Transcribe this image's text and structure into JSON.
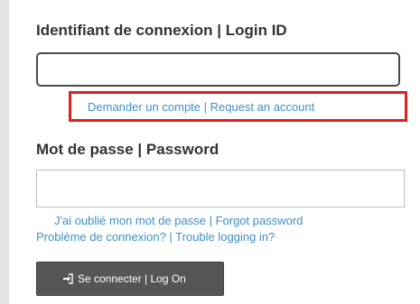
{
  "form": {
    "login_label": "Identifiant de connexion | Login ID",
    "login_value": "",
    "request_account_link": "Demander un compte | Request an account",
    "password_label": "Mot de passe | Password",
    "password_value": "",
    "forgot_password_link": "J'ai oublié mon mot de passe | Forgot password",
    "trouble_link": "Problème de connexion? | Trouble logging in?",
    "logon_button_label": "Se connecter | Log On",
    "logon_icon": "sign-in-icon"
  },
  "colors": {
    "link": "#3d8fc9",
    "label": "#333333",
    "highlight_box": "#e02020",
    "button_bg": "#565656"
  }
}
